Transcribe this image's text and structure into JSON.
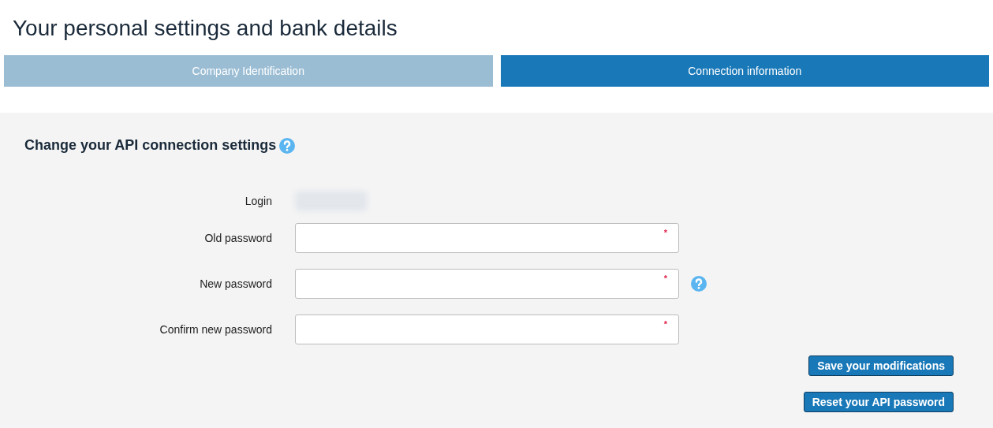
{
  "page_title": "Your personal settings and bank details",
  "tabs": [
    {
      "label": "Company Identification",
      "selected": false
    },
    {
      "label": "Connection information",
      "selected": true
    }
  ],
  "section": {
    "title": "Change your API connection settings",
    "help": true
  },
  "fields": [
    {
      "kind": "readonly",
      "label": "Login",
      "redacted": true
    },
    {
      "kind": "password",
      "label": "Old password",
      "required_mark": "*",
      "help": false
    },
    {
      "kind": "password",
      "label": "New password",
      "required_mark": "*",
      "help": true
    },
    {
      "kind": "password",
      "label": "Confirm new password",
      "required_mark": "*",
      "help": false
    }
  ],
  "buttons": [
    "Save your modifications",
    "Reset your API password"
  ]
}
